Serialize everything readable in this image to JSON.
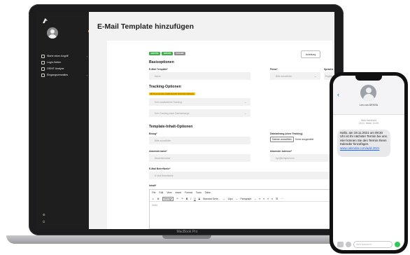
{
  "laptop": {
    "model_label": "MacBook Pro"
  },
  "sidebar": {
    "items": [
      {
        "label": "Starte einen Angriff",
        "icon": "target-icon"
      },
      {
        "label": "Login-Seiten",
        "icon": "login-icon"
      },
      {
        "label": "OSINT Analyse",
        "icon": "analysis-icon"
      },
      {
        "label": "Eingangsverwaltes",
        "icon": "inbox-icon"
      }
    ]
  },
  "page": {
    "title": "E-Mail Template hinzufügen",
    "anleitung": "Anleitung",
    "badges": [
      {
        "label": "GRUPPE",
        "color": "#3fae49"
      },
      {
        "label": "ANPASS",
        "color": "#3fae49"
      },
      {
        "label": "SCHABE",
        "color": "#8d8d8d"
      }
    ],
    "basisoptionen": {
      "heading": "Basisoptionen",
      "email_template_label": "E-Mail Template*",
      "email_template_placeholder": "Name",
      "firma_label": "Firma*",
      "firma_value": "Bitte auswählen",
      "sprache_label": "Sprache",
      "sprache_value": "Englisch"
    },
    "tracking": {
      "heading": "Tracking-Optionen",
      "notice": "BITTE EIN E-MAIL-TEMPLATE MIT TRACKING WÄHLEN",
      "select1": "Kein zusätzliches Tracking",
      "select2": "Kein Tracking einer Dateianhangs"
    },
    "inhalt": {
      "heading": "Template-Inhalt-Optionen",
      "bezug_label": "Bezug*",
      "bezug_value": "Bitte auswählen",
      "datei_label": "Dateianhang (ohne Tracking)",
      "datei_button": "Dateien auswählen",
      "datei_status": "Keine ausgewählt",
      "absendername_label": "Absendername*",
      "absendername_placeholder": "Absendername",
      "absenderadresse_label": "Absender Adresse*",
      "absenderadresse_placeholder": "xyz@beispiel.com",
      "betreff_label": "E-Mail Betreffzeile*",
      "betreff_placeholder": "E-Mail Betreffzeile",
      "inhalt_label": "Inhalt*"
    },
    "editor": {
      "menu": [
        "File",
        "Edit",
        "View",
        "Insert",
        "Format",
        "Tools",
        "Table"
      ],
      "buttons": [
        "Beiträge",
        "B",
        "I",
        "U",
        "S"
      ],
      "font_select": "Standart Serie...",
      "size_select": "14px",
      "block_select": "Paragraph",
      "body_placeholder": "Inhalt"
    }
  },
  "phone": {
    "contact_name": "Leo von DEKRA",
    "meta_line1": "Web-Nachricht",
    "meta_line2": "18.11. heute, 10:25",
    "message": "Hallo, am 19.11.2021 um 09:30 Uhr ist Ihr nächster Termin bei uns. Hier können Sie den Termin Ihrem Kalender hinzufügen.",
    "link": "www.calendar.com/add-2021",
    "input_placeholder": "Web-Nachricht"
  }
}
